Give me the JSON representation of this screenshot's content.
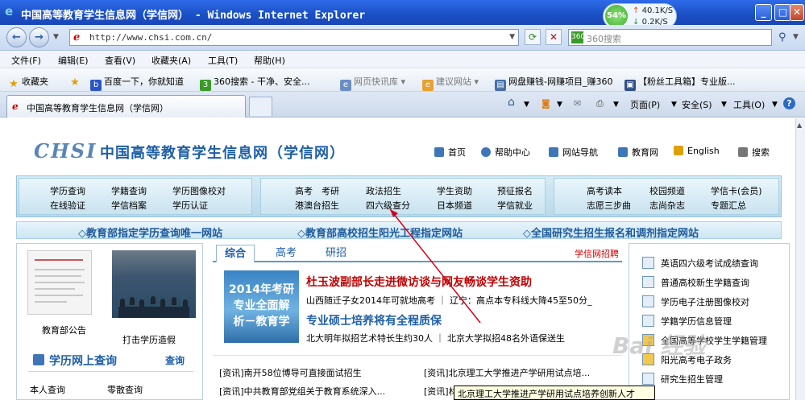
{
  "window": {
    "title": "中国高等教育学生信息网（学信网） - Windows Internet Explorer",
    "minimize": "_",
    "maximize": "□",
    "close": "✕"
  },
  "speed": {
    "percent": "54%",
    "up": "40.1K/S",
    "down": "0.2K/S"
  },
  "address": {
    "url": "http://www.chsi.com.cn/",
    "search_placeholder": "360搜索"
  },
  "menu": [
    "文件(F)",
    "编辑(E)",
    "查看(V)",
    "收藏夹(A)",
    "工具(T)",
    "帮助(H)"
  ],
  "favorites": {
    "label": "收藏夹",
    "items": [
      "百度一下，你就知道",
      "360搜索 - 干净、安全...",
      "网页快讯库",
      "建议网站",
      "网盘赚钱-网赚项目_赚360",
      "【粉丝工具箱】专业版..."
    ]
  },
  "tab": {
    "label": "中国高等教育学生信息网（学信网）"
  },
  "commands": {
    "page": "页面(P)",
    "safety": "安全(S)",
    "tools": "工具(O)",
    "help": "?"
  },
  "site": {
    "logo": "CHSI",
    "name": "中国高等教育学生信息网（学信网）",
    "toplinks": [
      "首页",
      "帮助中心",
      "网站导航",
      "教育网",
      "English",
      "搜索"
    ],
    "nav": {
      "group1": [
        [
          "学历查询",
          "学籍查询",
          "学历图像校对"
        ],
        [
          "在线验证",
          "学信档案",
          "学历认证"
        ]
      ],
      "group2": [
        [
          "高考　考研",
          "政法招生",
          "学生资助",
          "预征报名"
        ],
        [
          "港澳台招生",
          "四六级查分",
          "日本频道",
          "学信就业"
        ]
      ],
      "group3": [
        [
          "高考读本",
          "校园频道",
          "学信卡(会员)"
        ],
        [
          "志愿三步曲",
          "志尚杂志",
          "专题汇总"
        ]
      ]
    },
    "slogans": [
      "◇教育部指定学历查询唯一网站",
      "◇教育部高校招生阳光工程指定网站",
      "◇全国研究生招生报名和调剂指定网站"
    ],
    "left": {
      "caption1": "教育部公告",
      "caption2": "打击学历造假",
      "query_title": "学历网上查询",
      "query_btn": "查询",
      "link1": "本人查询",
      "link2": "零散查询"
    },
    "middle": {
      "tabs": [
        "综合",
        "高考",
        "研招"
      ],
      "recruit": "学信网招聘",
      "ad": "2014年考研\n专业全面解\n析－教育学",
      "headline1": "杜玉波副部长走进微访谈与网友畅谈学生资助",
      "sub1": "山西随迁子女2014年可就地高考 ｜ 辽宁：高点本专科线大降45至50分_",
      "headline2": "专业硕士培养将有全程质保",
      "sub2": "北大明年拟招艺术特长生约30人 ｜ 北京大学拟招48名外语保送生",
      "news": [
        "[资讯]南开58位博导可直接面试招生",
        "[资讯]北京理工大学推进产学研用试点培...",
        "[资讯]中共教育部党组关于教育系统深入...",
        "[资讯]材..."
      ]
    },
    "right": {
      "links": [
        "英语四六级考试成绩查询",
        "普通高校新生学籍查询",
        "学历电子注册图像校对",
        "学籍学历信息管理",
        "全国高等学校学生学籍管理",
        "阳光高考电子政务",
        "研究生招生管理"
      ]
    }
  },
  "tooltip": "北京理工大学推进产学研用试点培养创新人才",
  "watermark": "Bai 经验"
}
